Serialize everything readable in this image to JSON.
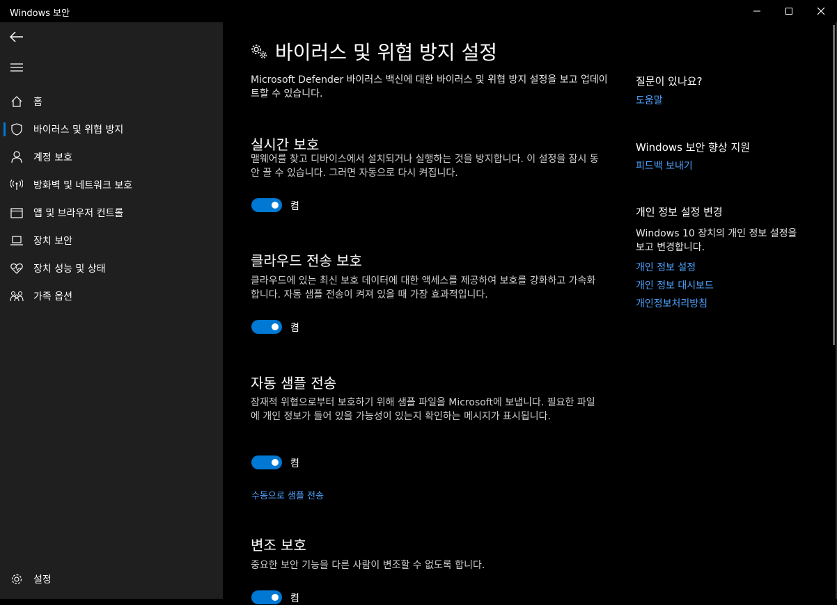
{
  "window": {
    "title": "Windows 보안"
  },
  "sidebar": {
    "items": [
      {
        "label": "홈",
        "icon": "home-icon"
      },
      {
        "label": "바이러스 및 위협 방지",
        "icon": "shield-icon",
        "active": true
      },
      {
        "label": "계정 보호",
        "icon": "person-icon"
      },
      {
        "label": "방화벽 및 네트워크 보호",
        "icon": "antenna-icon"
      },
      {
        "label": "앱 및 브라우저 컨트롤",
        "icon": "browser-window-icon"
      },
      {
        "label": "장치 보안",
        "icon": "laptop-icon"
      },
      {
        "label": "장치 성능 및 상태",
        "icon": "heart-pulse-icon"
      },
      {
        "label": "가족 옵션",
        "icon": "family-icon"
      }
    ],
    "settings_label": "설정"
  },
  "main": {
    "title": "바이러스 및 위협 방지 설정",
    "intro": "Microsoft Defender 바이러스 백신에 대한 바이러스 및 위협 방지 설정을 보고 업데이트할 수 있습니다.",
    "sections": [
      {
        "title": "실시간 보호",
        "desc": "맬웨어를 찾고 디바이스에서 설치되거나 실행하는 것을 방지합니다. 이 설정을 잠시 동안 끌 수 있습니다. 그러면 자동으로 다시 켜집니다.",
        "toggle_state": "켬"
      },
      {
        "title": "클라우드 전송 보호",
        "desc": "클라우드에 있는 최신 보호 데이터에 대한 액세스를 제공하여 보호를 강화하고 가속화합니다. 자동 샘플 전송이 켜져 있을 때 가장 효과적입니다.",
        "toggle_state": "켬"
      },
      {
        "title": "자동 샘플 전송",
        "desc": "잠재적 위협으로부터 보호하기 위해 샘플 파일을 Microsoft에 보냅니다. 필요한 파일에 개인 정보가 들어 있을 가능성이 있는지 확인하는 메시지가 표시됩니다.",
        "toggle_state": "켬",
        "link": "수동으로 샘플 전송"
      },
      {
        "title": "변조 보호",
        "desc": "중요한 보안 기능을 다른 사람이 변조할 수 없도록 합니다.",
        "toggle_state": "켬"
      }
    ]
  },
  "right": {
    "question_title": "질문이 있나요?",
    "help_link": "도움말",
    "improve_title": "Windows 보안 향상 지원",
    "feedback_link": "피드백 보내기",
    "privacy_title": "개인 정보 설정 변경",
    "privacy_desc": "Windows 10 장치의 개인 정보 설정을 보고 변경합니다.",
    "privacy_links": [
      "개인 정보 설정",
      "개인 정보 대시보드",
      "개인정보처리방침"
    ]
  },
  "colors": {
    "accent": "#0078d4",
    "link": "#4ea3ff",
    "sidebar_bg": "#1f1f1f",
    "main_bg": "#000000"
  }
}
